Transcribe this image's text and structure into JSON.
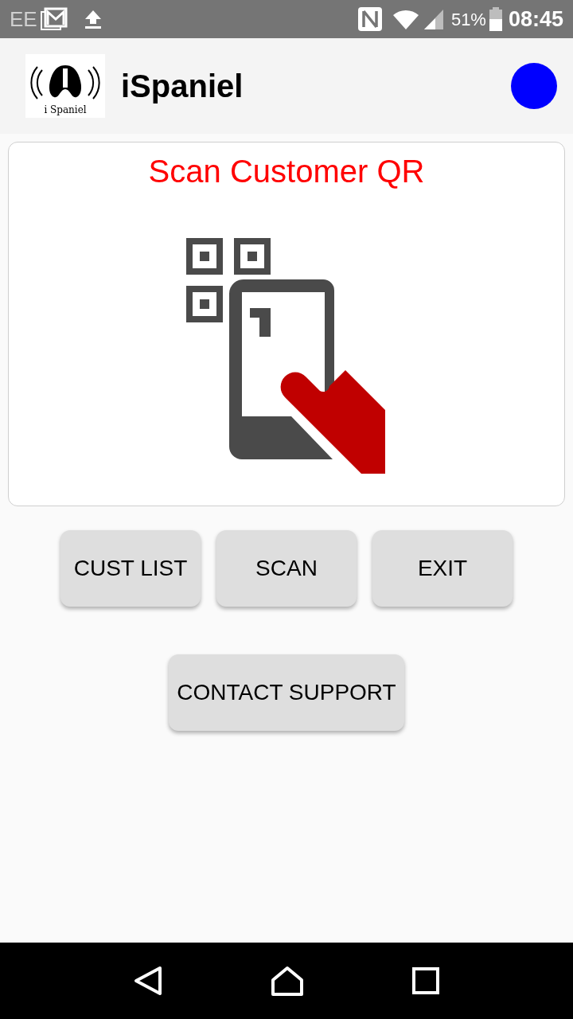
{
  "status_bar": {
    "carrier": "EE",
    "battery": "51%",
    "time": "08:45"
  },
  "app_bar": {
    "logo_text": "i Spaniel",
    "title": "iSpaniel",
    "status_indicator": {
      "color": "#0000ff"
    }
  },
  "scan_card": {
    "title": "Scan Customer QR"
  },
  "buttons": [
    {
      "label": "CUST LIST"
    },
    {
      "label": "SCAN"
    },
    {
      "label": "EXIT"
    }
  ],
  "support_button": {
    "label": "CONTACT SUPPORT"
  }
}
